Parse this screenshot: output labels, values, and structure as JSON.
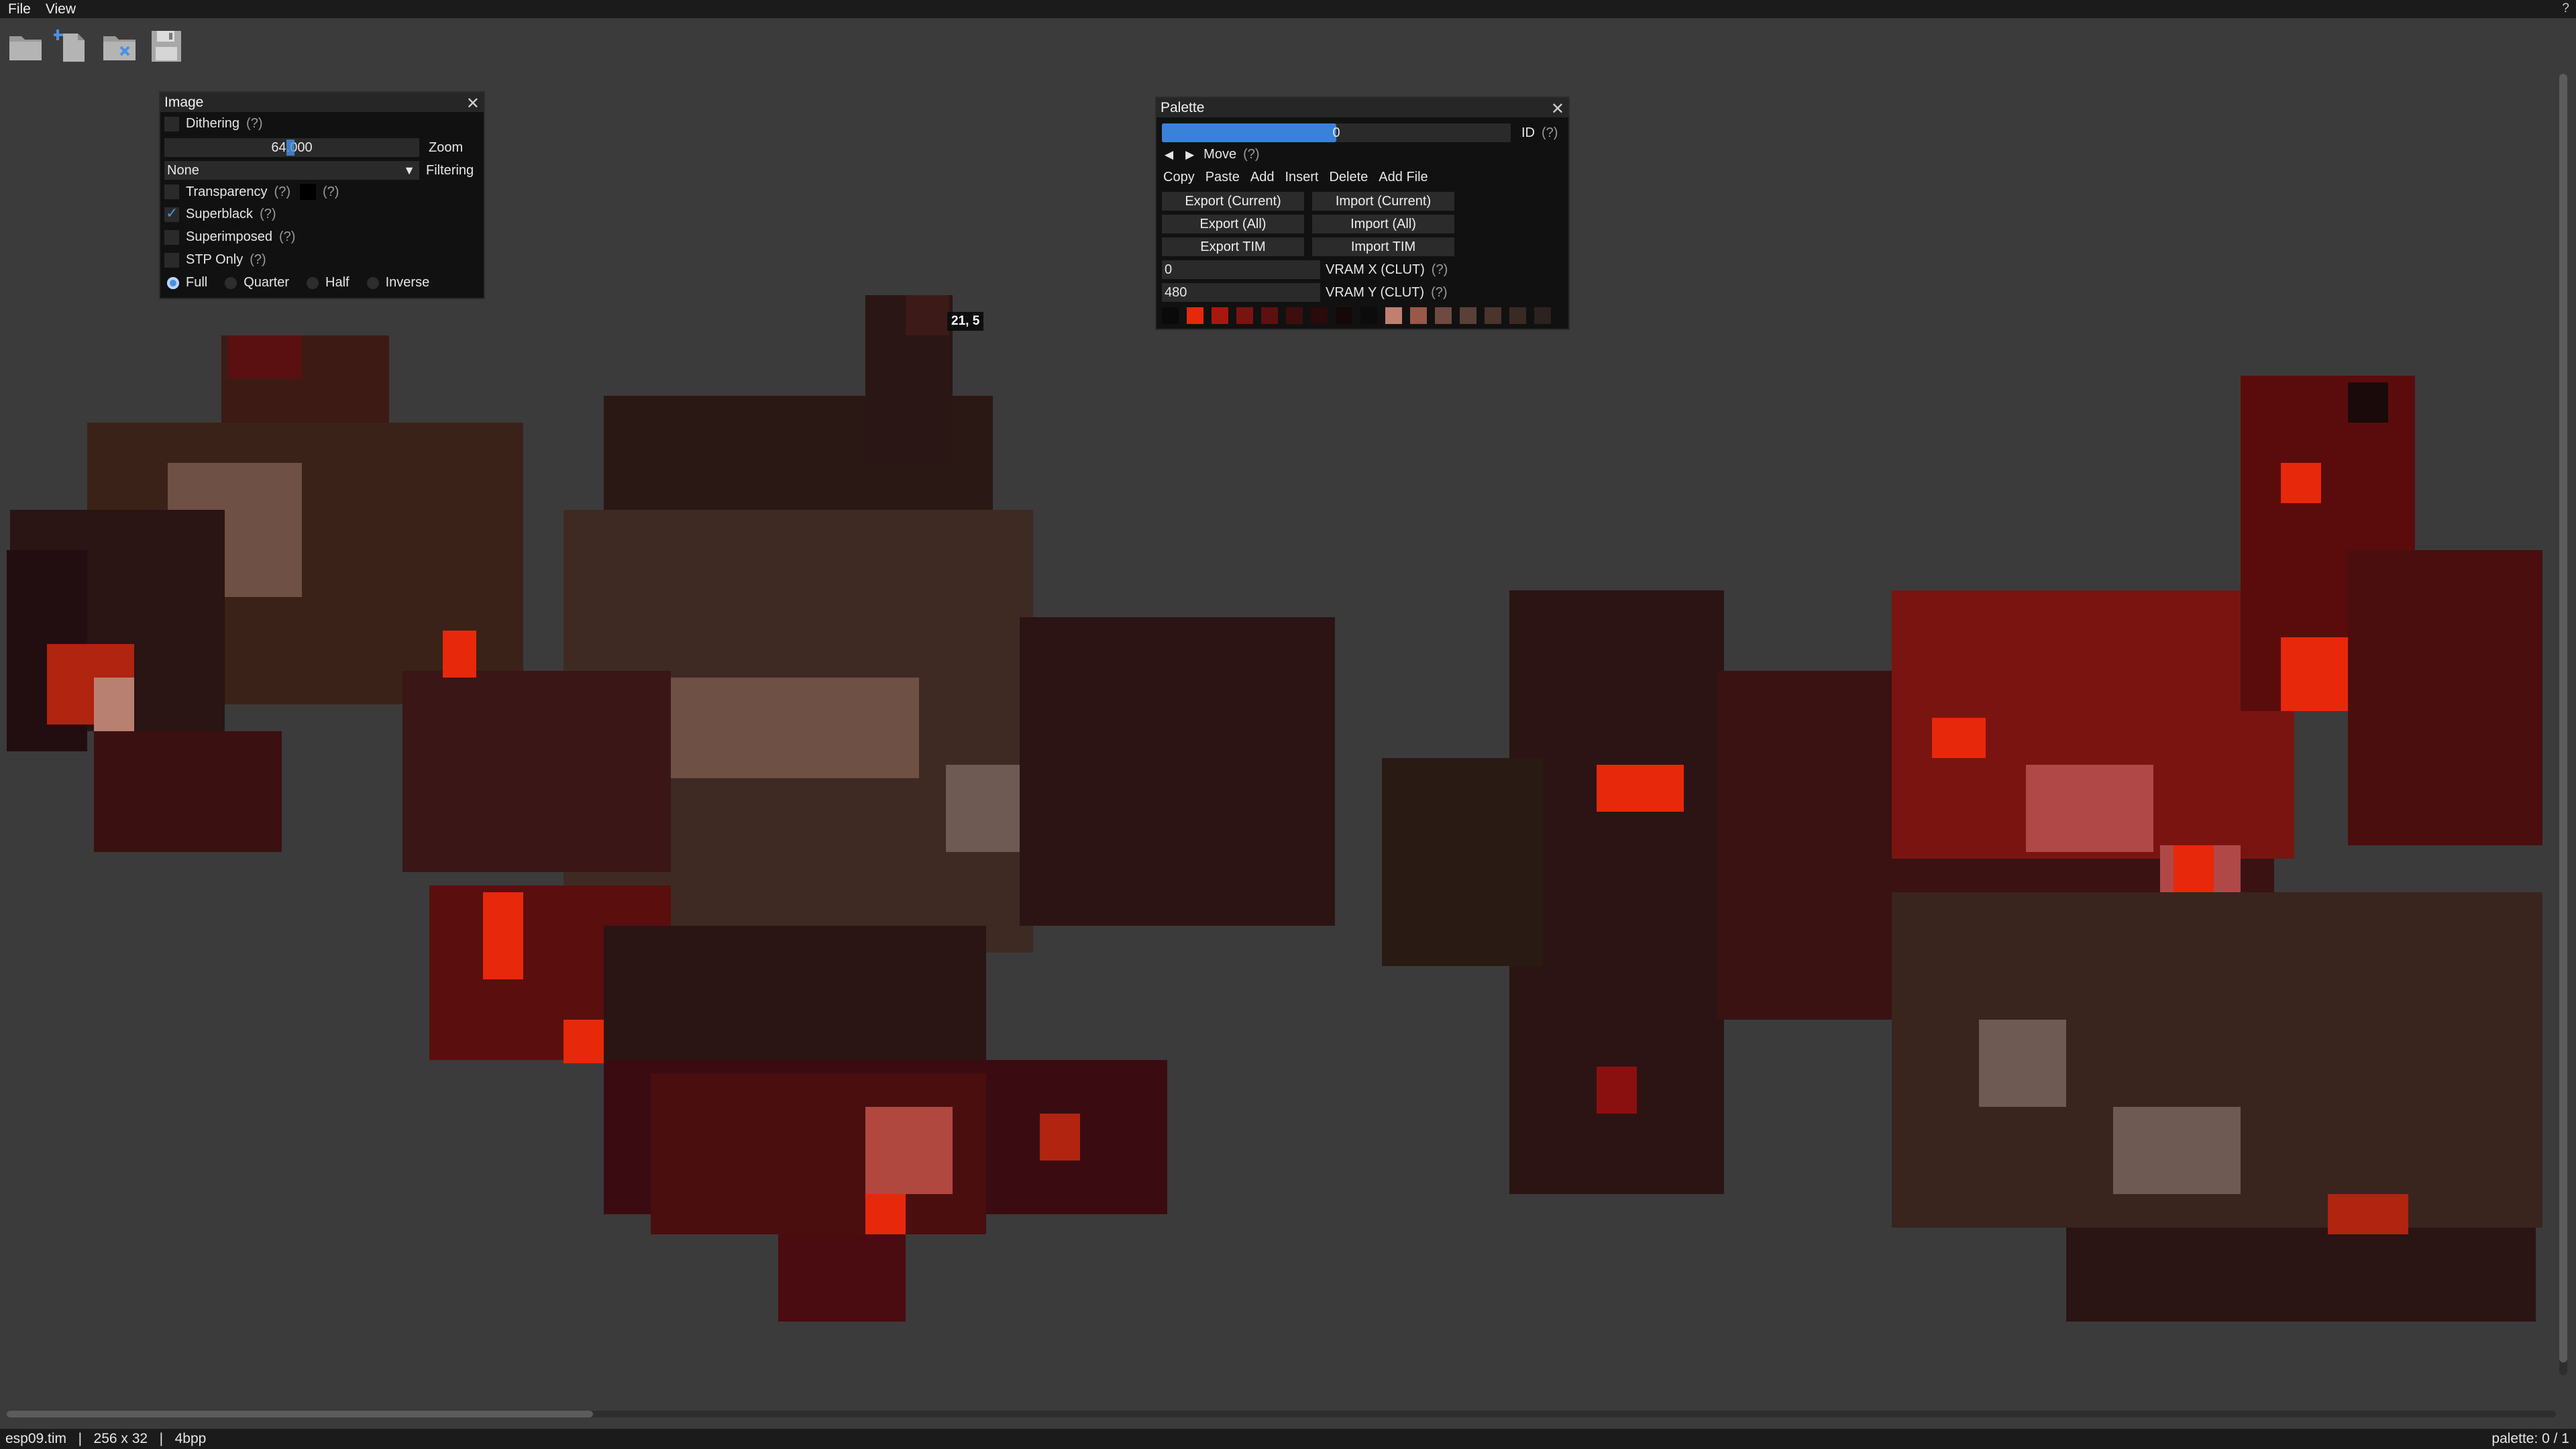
{
  "menu": {
    "file": "File",
    "view": "View",
    "help": "?"
  },
  "toolbar": {
    "items": [
      {
        "icon": "folder-icon",
        "name": "open"
      },
      {
        "icon": "new-file-icon",
        "name": "new"
      },
      {
        "icon": "close-folder-icon",
        "name": "close"
      },
      {
        "icon": "floppy-disk-icon",
        "name": "save"
      }
    ]
  },
  "image_panel": {
    "title": "Image",
    "dithering": {
      "label": "Dithering",
      "hint": "(?)",
      "checked": false
    },
    "zoom": {
      "value": "64.000",
      "label": "Zoom"
    },
    "filtering": {
      "value": "None",
      "label": "Filtering"
    },
    "transparency": {
      "label": "Transparency",
      "hint": "(?)",
      "hint2": "(?)",
      "checked": false
    },
    "superblack": {
      "label": "Superblack",
      "hint": "(?)",
      "checked": true
    },
    "superimposed": {
      "label": "Superimposed",
      "hint": "(?)",
      "checked": false
    },
    "stp_only": {
      "label": "STP Only",
      "hint": "(?)",
      "checked": false
    },
    "blend": {
      "options": [
        "Full",
        "Quarter",
        "Half",
        "Inverse"
      ],
      "selected": "Full"
    }
  },
  "palette_panel": {
    "title": "Palette",
    "id_value": "0",
    "id_fraction": 0.5,
    "id_label": "ID",
    "id_hint": "(?)",
    "move_label": "Move",
    "move_hint": "(?)",
    "actions": [
      "Copy",
      "Paste",
      "Add",
      "Insert",
      "Delete",
      "Add File"
    ],
    "export_current": "Export (Current)",
    "import_current": "Import (Current)",
    "export_all": "Export (All)",
    "import_all": "Import (All)",
    "export_tim": "Export TIM",
    "import_tim": "Import TIM",
    "vram_x_value": "0",
    "vram_x_label": "VRAM X (CLUT)",
    "vram_x_hint": "(?)",
    "vram_y_value": "480",
    "vram_y_label": "VRAM Y (CLUT)",
    "vram_y_hint": "(?)",
    "swatches": [
      "#0a0a0a",
      "#e8280a",
      "#a81810",
      "#7a1410",
      "#5e1010",
      "#3e0e0e",
      "#2a0a0a",
      "#160808",
      "#0c0c0c",
      "#c08070",
      "#9a5848",
      "#6e4a40",
      "#5a4038",
      "#4a342c",
      "#3a2a24",
      "#2c2220"
    ]
  },
  "tooltip": {
    "text": "21, 5"
  },
  "status": {
    "filename": "esp09.tim",
    "dimensions": "256 x 32",
    "depth": "4bpp",
    "sep": "|",
    "palette": "palette: 0 / 1"
  },
  "scroll": {
    "horizontal_fraction": 0.23,
    "vertical_fraction": 0.99
  },
  "colors": {
    "accent": "#4a90e2",
    "background": "#3b3b3b",
    "panel": "#111111"
  }
}
